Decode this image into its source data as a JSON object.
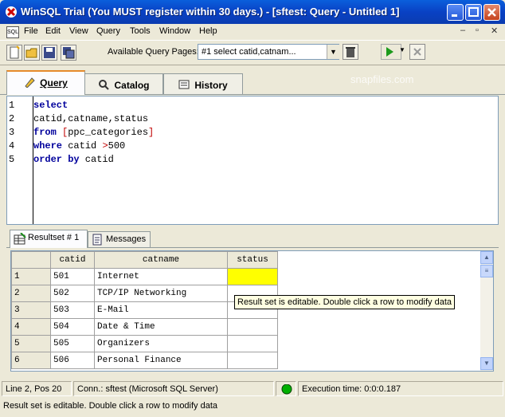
{
  "window": {
    "title": "WinSQL Trial (You MUST register within 30 days.) - [sftest: Query - Untitled 1]"
  },
  "menu": [
    "File",
    "Edit",
    "View",
    "Query",
    "Tools",
    "Window",
    "Help"
  ],
  "toolbar": {
    "query_pages_label": "Available Query Pages:",
    "query_pages_value": "#1 select  catid,catnam..."
  },
  "tabs": [
    {
      "label": "Query",
      "active": true
    },
    {
      "label": "Catalog",
      "active": false
    },
    {
      "label": "History",
      "active": false
    }
  ],
  "watermark": "snapfiles.com",
  "editor": {
    "line_numbers": [
      "1",
      "2",
      "3",
      "4",
      "5"
    ]
  },
  "result_tabs": [
    {
      "label": "Resultset # 1",
      "active": true
    },
    {
      "label": "Messages",
      "active": false
    }
  ],
  "grid": {
    "columns": [
      "catid",
      "catname",
      "status"
    ],
    "rows": [
      {
        "n": "1",
        "catid": "501",
        "catname": "Internet"
      },
      {
        "n": "2",
        "catid": "502",
        "catname": "TCP/IP Networking"
      },
      {
        "n": "3",
        "catid": "503",
        "catname": "E-Mail"
      },
      {
        "n": "4",
        "catid": "504",
        "catname": "Date & Time"
      },
      {
        "n": "5",
        "catid": "505",
        "catname": "Organizers"
      },
      {
        "n": "6",
        "catid": "506",
        "catname": "Personal Finance"
      }
    ]
  },
  "tooltip": "Result set is editable. Double click a row to modify data",
  "status": {
    "position": "Line 2, Pos 20",
    "connection": "Conn.: sftest (Microsoft SQL Server)",
    "execution_time": "Execution time: 0:0:0.187",
    "message": "Result set is editable. Double click a row to modify data"
  },
  "colors": {
    "title_bar": "#0a5fdc",
    "status_light": "#00b000",
    "selected_cell": "#ffff00"
  }
}
